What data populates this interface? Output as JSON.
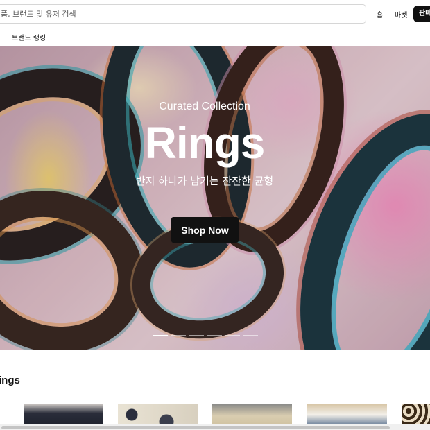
{
  "header": {
    "search_placeholder": "품, 브랜드 및 유저 검색",
    "nav_home": "홈",
    "nav_market": "마켓",
    "sell_button": "판매하기"
  },
  "subnav": {
    "brand_ranking": "브랜드 랭킹"
  },
  "hero": {
    "eyebrow": "Curated Collection",
    "title": "Rings",
    "subtitle": "반지 하나가 남기는 잔잔한 균형",
    "cta": "Shop Now",
    "slide_count": 6,
    "active_slide": 1
  },
  "section": {
    "title": "ings"
  },
  "colors": {
    "primary": "#111111",
    "background": "#ffffff"
  }
}
